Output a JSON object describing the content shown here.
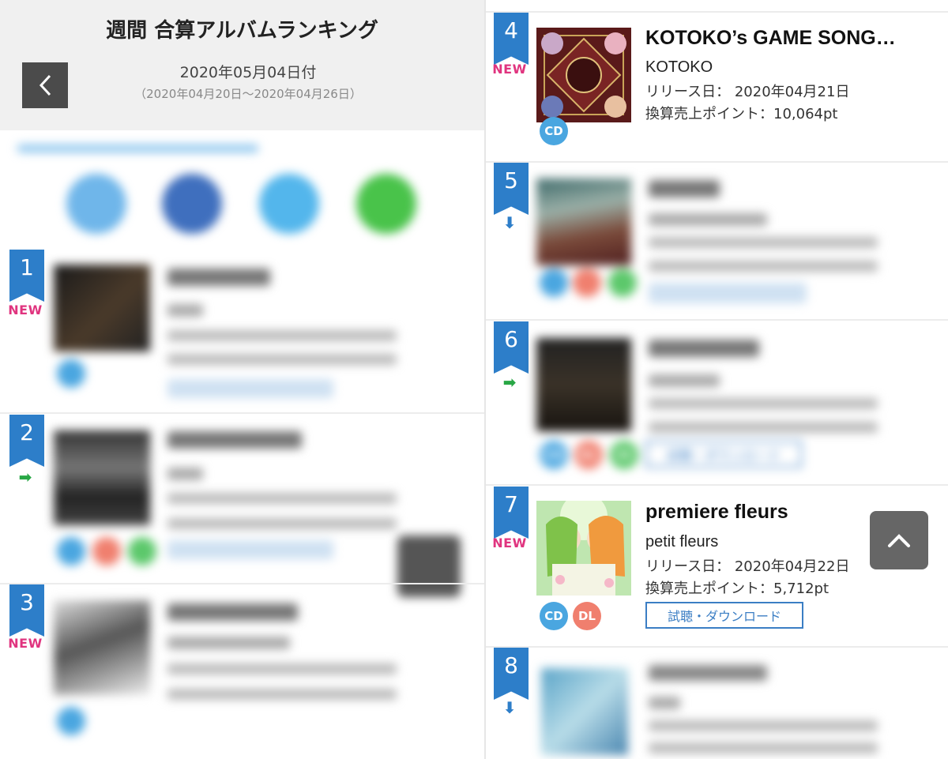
{
  "header": {
    "title": "週間 合算アルバムランキング",
    "date": "2020年05月04日付",
    "range": "（2020年04月20日～2020年04月26日）",
    "back_icon": "chevron-left-icon"
  },
  "share_icons": [
    "share-icon-1",
    "share-icon-2",
    "share-icon-3",
    "share-icon-4"
  ],
  "left_items": [
    {
      "rank": "1",
      "status": "NEW",
      "status_type": "new"
    },
    {
      "rank": "2",
      "status": "➡",
      "status_type": "right"
    },
    {
      "rank": "3",
      "status": "NEW",
      "status_type": "new"
    }
  ],
  "right_items": [
    {
      "rank": "4",
      "status": "NEW",
      "title": "KOTOKO’s GAME SONG…",
      "artist": "KOTOKO",
      "release_label": "リリース日：",
      "release_date": "2020年04月21日",
      "points_label": "換算売上ポイント：",
      "points": "10,064pt",
      "formats": [
        "CD"
      ]
    },
    {
      "rank": "5",
      "status": "⬇",
      "formats": [
        "",
        "",
        ""
      ]
    },
    {
      "rank": "6",
      "status": "➡",
      "formats": [
        "CD",
        "DL",
        "St"
      ],
      "button": "試聴・ダウンロード"
    },
    {
      "rank": "7",
      "status": "NEW",
      "title": "premiere fleurs",
      "artist": "petit fleurs",
      "release_label": "リリース日：",
      "release_date": "2020年04月22日",
      "points_label": "換算売上ポイント：",
      "points": "5,712pt",
      "formats": [
        "CD",
        "DL"
      ],
      "button": "試聴・ダウンロード"
    },
    {
      "rank": "8",
      "status": "⬇"
    }
  ],
  "scroll_top_icon": "chevron-up-icon",
  "colors": {
    "ribbon": "#2d7ec9",
    "new": "#e0347f",
    "down_arrow": "#2d7ec9",
    "right_arrow": "#28a745",
    "cd": "#4aa6e0",
    "dl": "#f07f6e",
    "st": "#5cc86b"
  }
}
